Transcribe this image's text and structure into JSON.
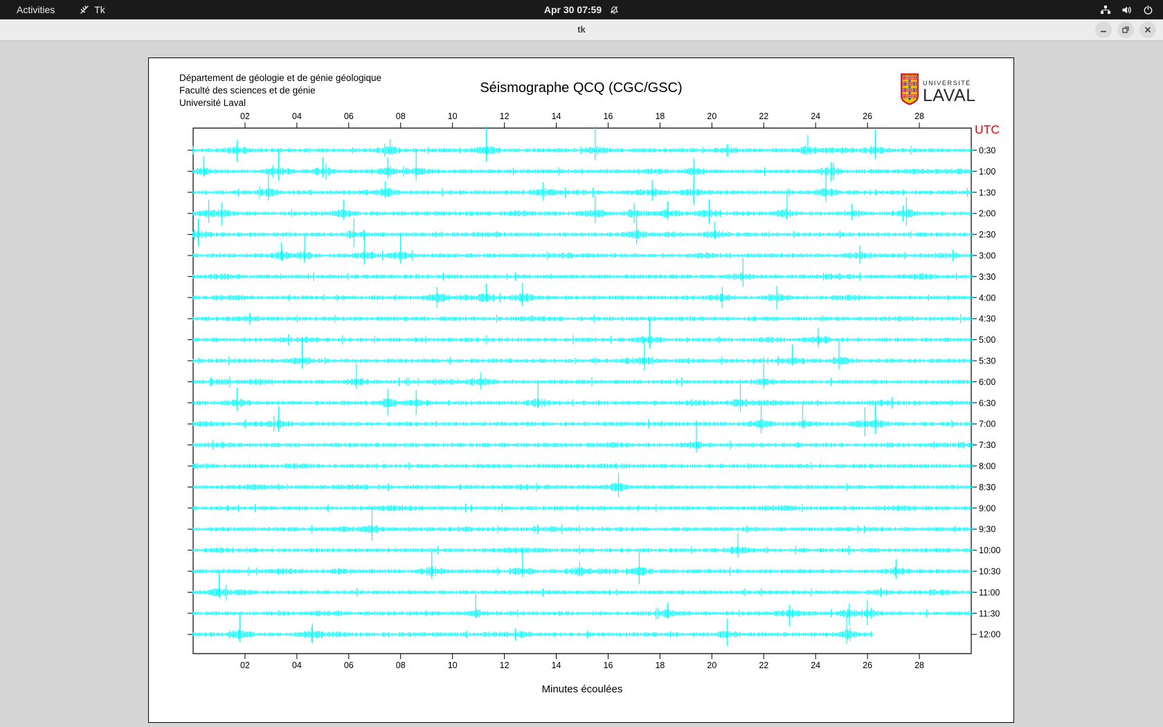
{
  "top_bar": {
    "activities": "Activities",
    "app_menu": "Tk",
    "clock": "Apr 30 07:59",
    "icons": [
      "tk-app-icon",
      "notifications-disabled-icon",
      "network-wired-icon",
      "volume-icon",
      "power-icon"
    ]
  },
  "window": {
    "title": "tk",
    "buttons": [
      "minimize",
      "maximize",
      "close"
    ]
  },
  "document": {
    "institution": [
      "Département de géologie et de génie géologique",
      "Faculté des sciences et de génie",
      "Université Laval"
    ],
    "title": "Séismographe QCQ (CGC/GSC)",
    "logo": {
      "line1": "UNIVERSITÉ",
      "line2": "LAVAL"
    }
  },
  "chart_data": {
    "type": "line",
    "subtype": "seismogram-helicorder",
    "title": "Séismographe QCQ (CGC/GSC)",
    "xlabel": "Minutes écoulées",
    "right_axis_label": "UTC",
    "x_range": [
      0,
      30
    ],
    "x_ticks": [
      "02",
      "04",
      "06",
      "08",
      "10",
      "12",
      "14",
      "16",
      "18",
      "20",
      "22",
      "24",
      "26",
      "28"
    ],
    "grid": false,
    "trace_color": "#00ffff",
    "utc_label_color": "#ff0000",
    "axis_color": "#000000",
    "rows": [
      {
        "utc": "0:30",
        "spikes": [
          1.7,
          7.6,
          11.3,
          15.5,
          23.7,
          26.3
        ]
      },
      {
        "utc": "1:00",
        "spikes": [
          0.4,
          3.3,
          5.0,
          7.5,
          8.6,
          19.3,
          24.6
        ]
      },
      {
        "utc": "1:30",
        "spikes": [
          2.9,
          7.4,
          13.5,
          17.7,
          19.3,
          24.4
        ]
      },
      {
        "utc": "2:00",
        "spikes": [
          0.6,
          1.1,
          5.8,
          15.5,
          17.0,
          18.3,
          19.9,
          22.9,
          25.4,
          27.5
        ]
      },
      {
        "utc": "2:30",
        "spikes": [
          0.2,
          6.2,
          17.1,
          20.1
        ]
      },
      {
        "utc": "3:00",
        "spikes": [
          3.4,
          4.3,
          6.6,
          8.0,
          25.7
        ]
      },
      {
        "utc": "3:30",
        "spikes": [
          21.2
        ]
      },
      {
        "utc": "4:00",
        "spikes": [
          9.4,
          11.3,
          12.7,
          20.4,
          22.5
        ]
      },
      {
        "utc": "4:30",
        "spikes": []
      },
      {
        "utc": "5:00",
        "spikes": [
          17.6,
          24.1
        ]
      },
      {
        "utc": "5:30",
        "spikes": [
          4.2,
          17.4,
          23.1,
          24.9
        ]
      },
      {
        "utc": "6:00",
        "spikes": [
          6.3,
          11.1,
          22.0
        ]
      },
      {
        "utc": "6:30",
        "spikes": [
          1.7,
          7.5,
          8.6,
          13.3,
          21.1
        ]
      },
      {
        "utc": "7:00",
        "spikes": [
          3.3,
          21.9,
          23.5,
          25.9,
          26.3
        ]
      },
      {
        "utc": "7:30",
        "spikes": [
          19.4
        ]
      },
      {
        "utc": "8:00",
        "spikes": []
      },
      {
        "utc": "8:30",
        "spikes": [
          16.4
        ]
      },
      {
        "utc": "9:00",
        "spikes": []
      },
      {
        "utc": "9:30",
        "spikes": [
          6.9
        ]
      },
      {
        "utc": "10:00",
        "spikes": [
          21.0
        ]
      },
      {
        "utc": "10:30",
        "spikes": [
          9.2,
          12.7,
          14.9,
          17.2,
          27.1
        ]
      },
      {
        "utc": "11:00",
        "spikes": [
          1.0
        ]
      },
      {
        "utc": "11:30",
        "spikes": [
          10.9,
          18.3,
          23.0,
          25.3,
          26.0
        ]
      },
      {
        "utc": "12:00",
        "spikes": [
          1.8,
          4.6,
          20.6,
          25.2
        ],
        "end_minute": 26.2
      }
    ]
  }
}
